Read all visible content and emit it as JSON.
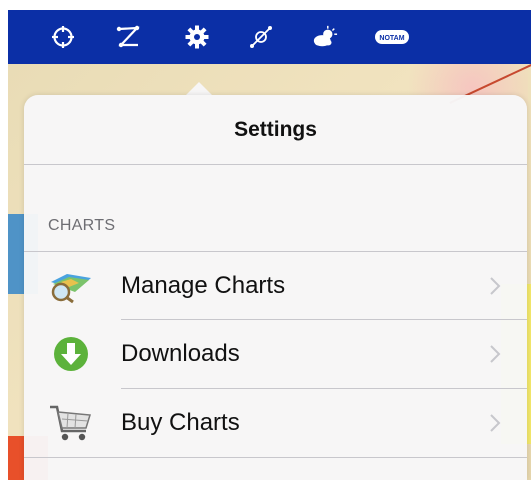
{
  "toolbar": {
    "icons": [
      {
        "name": "crosshair-icon"
      },
      {
        "name": "route-icon"
      },
      {
        "name": "gear-icon"
      },
      {
        "name": "ruler-icon"
      },
      {
        "name": "weather-icon"
      },
      {
        "name": "notam-icon",
        "label": "NOTAM"
      }
    ],
    "color": "#0b2fa6"
  },
  "popover": {
    "title": "Settings",
    "section_header": "CHARTS",
    "rows": [
      {
        "label": "Manage Charts",
        "icon": "manage-charts-icon"
      },
      {
        "label": "Downloads",
        "icon": "downloads-icon"
      },
      {
        "label": "Buy Charts",
        "icon": "shopping-cart-icon"
      }
    ]
  },
  "colors": {
    "accent_green": "#5cb23b",
    "chevron": "#c7c7cc"
  }
}
